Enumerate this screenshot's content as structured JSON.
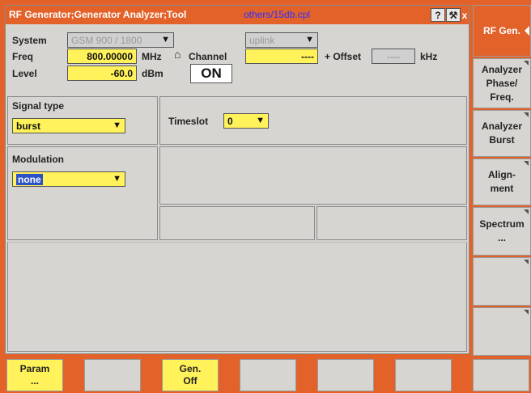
{
  "titlebar": {
    "title": "RF Generator;Generator Analyzer;Tool",
    "filename": "others/15db.cpl",
    "help": "?",
    "tool": "⚒",
    "close": "x"
  },
  "settings": {
    "system_label": "System",
    "system_value": "GSM 900 / 1800",
    "link_value": "uplink",
    "freq_label": "Freq",
    "freq_value": "800.00000",
    "freq_unit": "MHz",
    "channel_symbol": "⌂",
    "channel_label": "Channel",
    "channel_value": "----",
    "offset_label": "+ Offset",
    "offset_value": "----",
    "offset_unit": "kHz",
    "level_label": "Level",
    "level_value": "-60.0",
    "level_unit": "dBm",
    "on_label": "ON"
  },
  "signal": {
    "label": "Signal type",
    "value": "burst",
    "timeslot_label": "Timeslot",
    "timeslot_value": "0"
  },
  "modulation": {
    "label": "Modulation",
    "value": "none"
  },
  "right_menu": [
    {
      "label": "RF Gen."
    },
    {
      "label": "Analyzer\nPhase/\nFreq."
    },
    {
      "label": "Analyzer\nBurst"
    },
    {
      "label": "Align-\nment"
    },
    {
      "label": "Spectrum\n..."
    },
    {
      "label": ""
    },
    {
      "label": ""
    }
  ],
  "softkeys": [
    {
      "label": "Param\n..."
    },
    {
      "label": ""
    },
    {
      "label": "Gen.\nOff"
    },
    {
      "label": ""
    },
    {
      "label": ""
    },
    {
      "label": ""
    },
    {
      "label": ""
    }
  ],
  "colors": {
    "accent": "#e2622a",
    "field_yellow": "#fff25a",
    "panel": "#d6d5d1"
  }
}
